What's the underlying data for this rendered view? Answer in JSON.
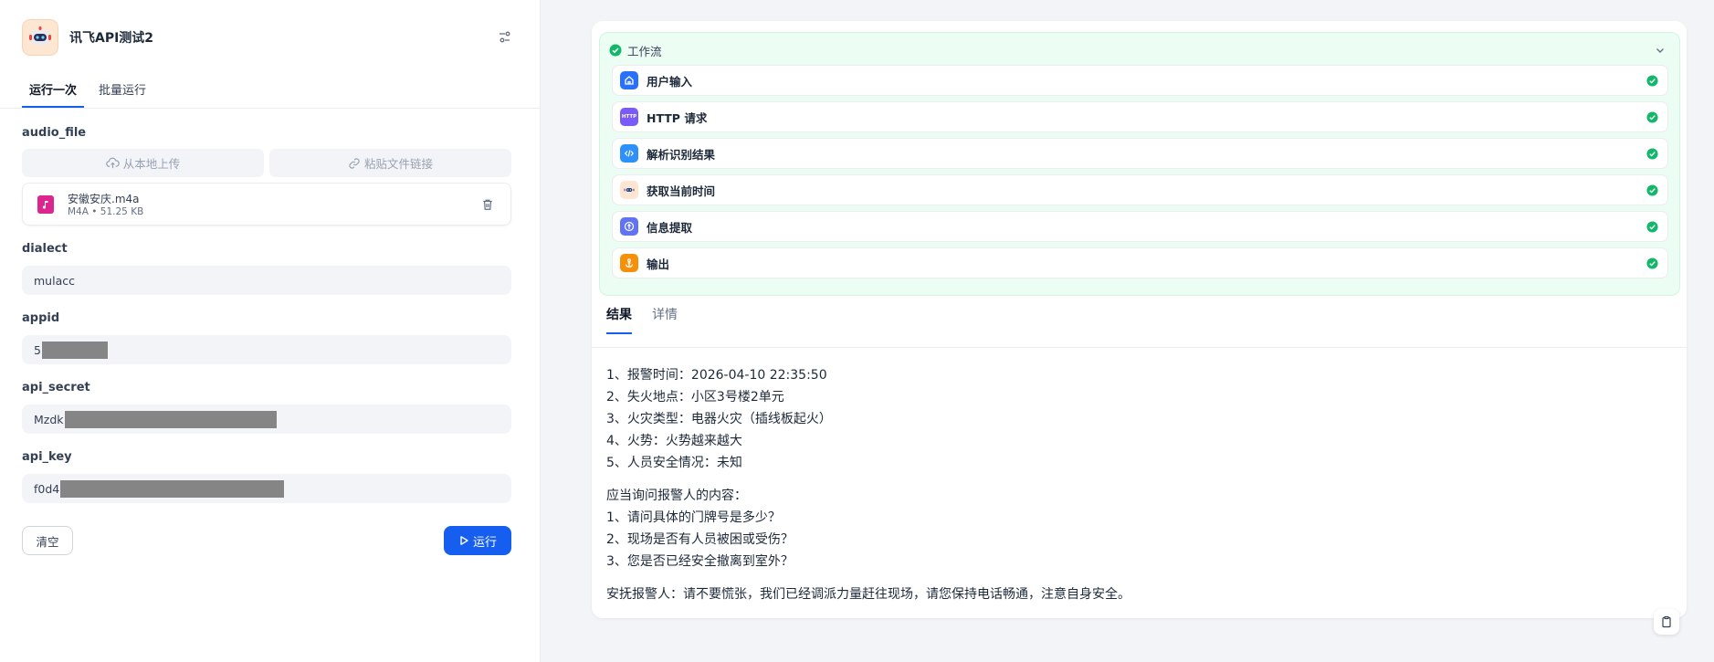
{
  "app": {
    "title": "讯飞API测试2",
    "icon": "robot-icon"
  },
  "tabs": [
    {
      "label": "运行一次",
      "active": true
    },
    {
      "label": "批量运行",
      "active": false
    }
  ],
  "form": {
    "audio_file": {
      "label": "audio_file",
      "upload_local": "从本地上传",
      "paste_link": "粘贴文件链接",
      "file": {
        "name": "安徽安庆.m4a",
        "meta": "M4A • 51.25 KB"
      }
    },
    "dialect": {
      "label": "dialect",
      "value": "mulacc"
    },
    "appid": {
      "label": "appid",
      "value": "5"
    },
    "api_secret": {
      "label": "api_secret",
      "value": "Mzdk"
    },
    "api_key": {
      "label": "api_key",
      "value": "f0d4"
    }
  },
  "buttons": {
    "clear": "清空",
    "run": "运行"
  },
  "workflow": {
    "title": "工作流",
    "status_color": "#12b76a",
    "steps": [
      {
        "label": "用户输入",
        "icon": "home-icon",
        "color": "#2970ff"
      },
      {
        "label": "HTTP 请求",
        "icon": "http-icon",
        "icon_text": "HTTP",
        "color": "#7a5af8"
      },
      {
        "label": "解析识别结果",
        "icon": "code-icon",
        "color": "#2e90fa"
      },
      {
        "label": "获取当前时间",
        "icon": "robot-icon",
        "color": "#fde7d3"
      },
      {
        "label": "信息提取",
        "icon": "info-extract-icon",
        "color": "#6172f3"
      },
      {
        "label": "输出",
        "icon": "output-icon",
        "color": "#f79009"
      }
    ]
  },
  "result_tabs": [
    {
      "label": "结果",
      "active": true
    },
    {
      "label": "详情",
      "active": false
    }
  ],
  "result": {
    "lines_1": [
      "1、报警时间：2026-04-10 22:35:50",
      "2、失火地点：小区3号楼2单元",
      "3、火灾类型：电器火灾（插线板起火）",
      "4、火势：火势越来越大",
      "5、人员安全情况：未知"
    ],
    "lines_2": [
      "应当询问报警人的内容：",
      "1、请问具体的门牌号是多少？",
      "2、现场是否有人员被困或受伤？",
      "3、您是否已经安全撤离到室外？"
    ],
    "line_3": "安抚报警人：请不要慌张，我们已经调派力量赶往现场，请您保持电话畅通，注意自身安全。"
  }
}
